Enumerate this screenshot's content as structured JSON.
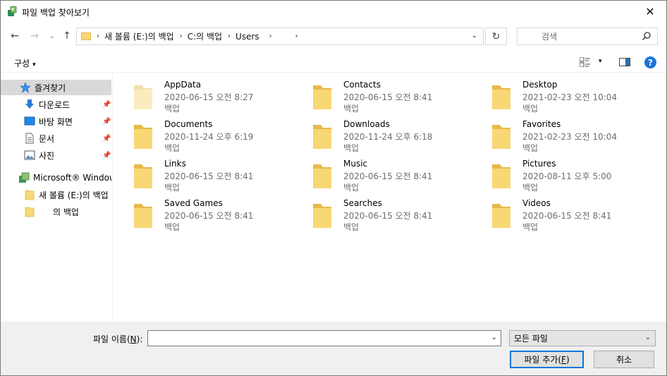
{
  "window": {
    "title": "파일 백업 찾아보기",
    "close_glyph": "✕"
  },
  "nav": {
    "back_glyph": "←",
    "forward_glyph": "→",
    "recent_glyph": "⌄",
    "up_glyph": "↑"
  },
  "address": {
    "crumbs": [
      "새 볼륨 (E:)의 백업",
      "C:의 백업",
      "Users"
    ],
    "separator": "›",
    "dropdown_glyph": "⌄",
    "refresh_glyph": "↻"
  },
  "search": {
    "placeholder": "검색"
  },
  "toolbar": {
    "organize_label": "구성",
    "caret": "▾",
    "help_label": "?"
  },
  "sidebar": {
    "items": [
      {
        "label": "즐겨찾기",
        "icon": "star-icon",
        "selected": true,
        "pinned": false
      },
      {
        "label": "다운로드",
        "icon": "download-icon",
        "selected": false,
        "pinned": true
      },
      {
        "label": "바탕 화면",
        "icon": "desktop-icon",
        "selected": false,
        "pinned": true
      },
      {
        "label": "문서",
        "icon": "document-icon",
        "selected": false,
        "pinned": true
      },
      {
        "label": "사진",
        "icon": "pictures-icon",
        "selected": false,
        "pinned": true
      },
      {
        "label": "Microsoft® Windows",
        "icon": "windows-backup-icon",
        "selected": false,
        "pinned": false
      },
      {
        "label": "새 볼륨 (E:)의 백업",
        "icon": "folder-icon",
        "selected": false,
        "pinned": false
      },
      {
        "label": "의 백업",
        "icon": "folder-icon",
        "selected": false,
        "pinned": false
      }
    ],
    "pin_glyph": "📌"
  },
  "files": [
    {
      "name": "AppData",
      "date": "2020-06-15 오전 8:27",
      "type": "백업",
      "faded": true
    },
    {
      "name": "Contacts",
      "date": "2020-06-15 오전 8:41",
      "type": "백업",
      "faded": false
    },
    {
      "name": "Desktop",
      "date": "2021-02-23 오전 10:04",
      "type": "백업",
      "faded": false
    },
    {
      "name": "Documents",
      "date": "2020-11-24 오후 6:19",
      "type": "백업",
      "faded": false
    },
    {
      "name": "Downloads",
      "date": "2020-11-24 오후 6:18",
      "type": "백업",
      "faded": false
    },
    {
      "name": "Favorites",
      "date": "2021-02-23 오전 10:04",
      "type": "백업",
      "faded": false
    },
    {
      "name": "Links",
      "date": "2020-06-15 오전 8:41",
      "type": "백업",
      "faded": false
    },
    {
      "name": "Music",
      "date": "2020-06-15 오전 8:41",
      "type": "백업",
      "faded": false
    },
    {
      "name": "Pictures",
      "date": "2020-08-11 오후 5:00",
      "type": "백업",
      "faded": false
    },
    {
      "name": "Saved Games",
      "date": "2020-06-15 오전 8:41",
      "type": "백업",
      "faded": false
    },
    {
      "name": "Searches",
      "date": "2020-06-15 오전 8:41",
      "type": "백업",
      "faded": false
    },
    {
      "name": "Videos",
      "date": "2020-06-15 오전 8:41",
      "type": "백업",
      "faded": false
    }
  ],
  "bottom": {
    "filename_label_pre": "파일 이름(",
    "filename_label_key": "N",
    "filename_label_post": "):",
    "filename_value": "",
    "filetype_selected": "모든 파일",
    "add_button_pre": "파일 추가(",
    "add_button_key": "F",
    "add_button_post": ")",
    "cancel_button": "취소",
    "dropdown_glyph": "⌄"
  },
  "colors": {
    "folder": "#f8d775",
    "folder_dark": "#e8b94a",
    "accent": "#0078d7"
  }
}
